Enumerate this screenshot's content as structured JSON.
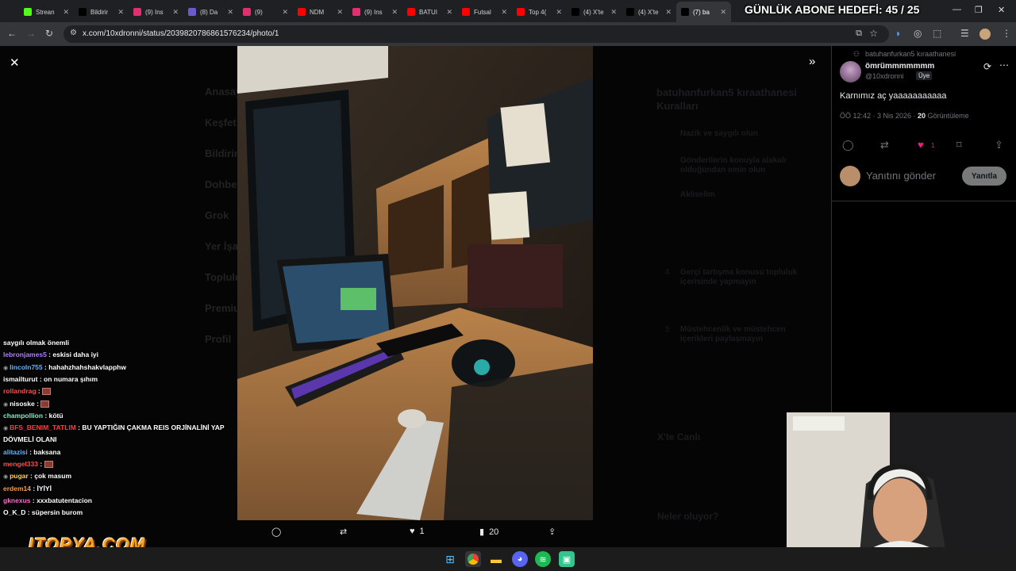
{
  "browser": {
    "tabs": [
      {
        "label": "Strean",
        "color": "#53fc18"
      },
      {
        "label": "Bildirir",
        "color": "#000000"
      },
      {
        "label": "(9) Ins",
        "color": "#e1306c"
      },
      {
        "label": "(8) Da",
        "color": "#6a5acd"
      },
      {
        "label": "(9)",
        "color": "#e1306c"
      },
      {
        "label": "NDM",
        "color": "#ff0000"
      },
      {
        "label": "(9) Ins",
        "color": "#e1306c"
      },
      {
        "label": "BATUI",
        "color": "#ff0000"
      },
      {
        "label": "Futsal",
        "color": "#ff0000"
      },
      {
        "label": "Top 4(",
        "color": "#ff0000"
      },
      {
        "label": "(4) X'te",
        "color": "#000000"
      },
      {
        "label": "(4) X'te",
        "color": "#000000"
      },
      {
        "label": "(7) ba",
        "color": "#000000"
      }
    ],
    "url": "x.com/10xdronni/status/2039820786861576234/photo/1"
  },
  "overlay": {
    "goal": "GÜNLÜK ABONE HEDEFİ: 45 / 25",
    "logo": "ITOPYA.COM"
  },
  "photo_viewer": {
    "actions": {
      "reply_count": "",
      "like_count": "1",
      "views_count": "20"
    }
  },
  "post": {
    "community": "batuhanfurkan5 kıraathanesi",
    "display_name": "ömrümmmmmmm",
    "handle": "@10xdronni",
    "badge": "Üye",
    "text": "Karnımız aç yaaaaaaaaaaa",
    "time": "ÖÖ 12:42 · 3 Nis 2026 · ",
    "views_number": "20",
    "views_label": " Görüntüleme",
    "like_count": "1",
    "reply_placeholder": "Yanıtını gönder",
    "reply_button": "Yanıtla"
  },
  "background_page": {
    "nav": [
      "Anasayfa",
      "Keşfet",
      "Bildirimler",
      "Dohbet",
      "Grok",
      "Yer İşaretleri",
      "Topluluklar",
      "Premium",
      "Profil"
    ],
    "rules_title": "batuhanfurkan5 kıraathanesi Kuralları",
    "rules": [
      {
        "n": "",
        "text": "Nazik ve saygılı olun"
      },
      {
        "n": "",
        "text": "Gönderilerin konuyla alakalı olduğundan emin olun"
      },
      {
        "n": "",
        "text": "Aklıselim"
      },
      {
        "n": "4",
        "text": "Gerçi tartışma konusu topluluk içerisinde yapmayın"
      },
      {
        "n": "5",
        "text": "Müstehcenlik ve müstehcen içerikleri paylaşmayın"
      }
    ],
    "live": "X'te Canlı",
    "whats_happening": "Neler oluyor?"
  },
  "chat": [
    {
      "user": "",
      "user_color": "#ffffff",
      "msg": "saygılı olmak önemli",
      "icon": false
    },
    {
      "user": "lebronjames5",
      "user_color": "#b57cff",
      "msg": "eskisi daha iyi",
      "icon": false
    },
    {
      "user": "lincoln755",
      "user_color": "#5fb7ff",
      "msg": "hahahzhahshakvlapphw",
      "icon": true
    },
    {
      "user": "ismailturut",
      "user_color": "#ffffff",
      "msg": "on numara şıhım",
      "icon": false
    },
    {
      "user": "rollandrag",
      "user_color": "#ff4d4d",
      "msg": "",
      "icon": false,
      "emote": true
    },
    {
      "user": "nisoske",
      "user_color": "#ffffff",
      "msg": "",
      "icon": true,
      "emote": true
    },
    {
      "user": "champollion",
      "user_color": "#7ef0c6",
      "msg": "kötü",
      "icon": false
    },
    {
      "user": "BFS_BENIM_TATLIM",
      "user_color": "#ff3b3b",
      "msg": "BU YAPTIĞIN ÇAKMA REIS ORJİNALİNİ YAP",
      "icon": true
    },
    {
      "user": "",
      "user_color": "#ffffff",
      "msg": "DÖVMELİ OLANI",
      "icon": false
    },
    {
      "user": "alitazisi",
      "user_color": "#5fb7ff",
      "msg": "baksana",
      "icon": false
    },
    {
      "user": "mengel333",
      "user_color": "#ff4d4d",
      "msg": "",
      "icon": false,
      "emote": true
    },
    {
      "user": "pugar",
      "user_color": "#ffd24d",
      "msg": "çok masum",
      "icon": true
    },
    {
      "user": "erdem14",
      "user_color": "#ff9b3d",
      "msg": "İYİYİ",
      "icon": false
    },
    {
      "user": "gknexus",
      "user_color": "#ff6ad5",
      "msg": "xxxbatutentacion",
      "icon": false
    },
    {
      "user": "O_K_D",
      "user_color": "#ffffff",
      "msg": "süpersin burom",
      "icon": false
    }
  ]
}
